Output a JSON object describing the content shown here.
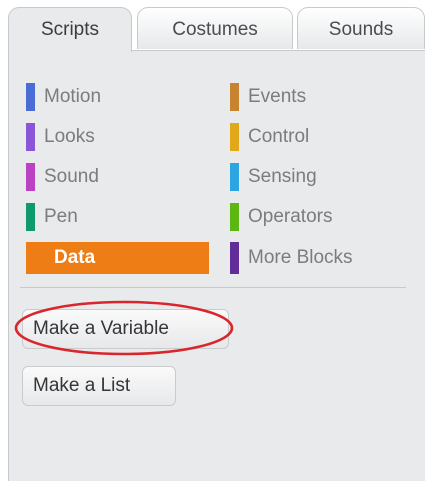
{
  "tabs": [
    {
      "label": "Scripts",
      "active": true
    },
    {
      "label": "Costumes",
      "active": false
    },
    {
      "label": "Sounds",
      "active": false
    }
  ],
  "categories": {
    "left": [
      {
        "label": "Motion",
        "color": "#4a6cd4"
      },
      {
        "label": "Looks",
        "color": "#8a55d7"
      },
      {
        "label": "Sound",
        "color": "#bb42c3"
      },
      {
        "label": "Pen",
        "color": "#0e9a6c"
      },
      {
        "label": "Data",
        "color": "#ee7d16",
        "selected": true
      }
    ],
    "right": [
      {
        "label": "Events",
        "color": "#c88330"
      },
      {
        "label": "Control",
        "color": "#e1a91a"
      },
      {
        "label": "Sensing",
        "color": "#2ca5e2"
      },
      {
        "label": "Operators",
        "color": "#5cb712"
      },
      {
        "label": "More Blocks",
        "color": "#632d99"
      }
    ]
  },
  "buttons": {
    "make_variable": "Make a Variable",
    "make_list": "Make a List"
  },
  "annotation": {
    "highlight_color": "#d9252c",
    "target": "make_variable"
  }
}
